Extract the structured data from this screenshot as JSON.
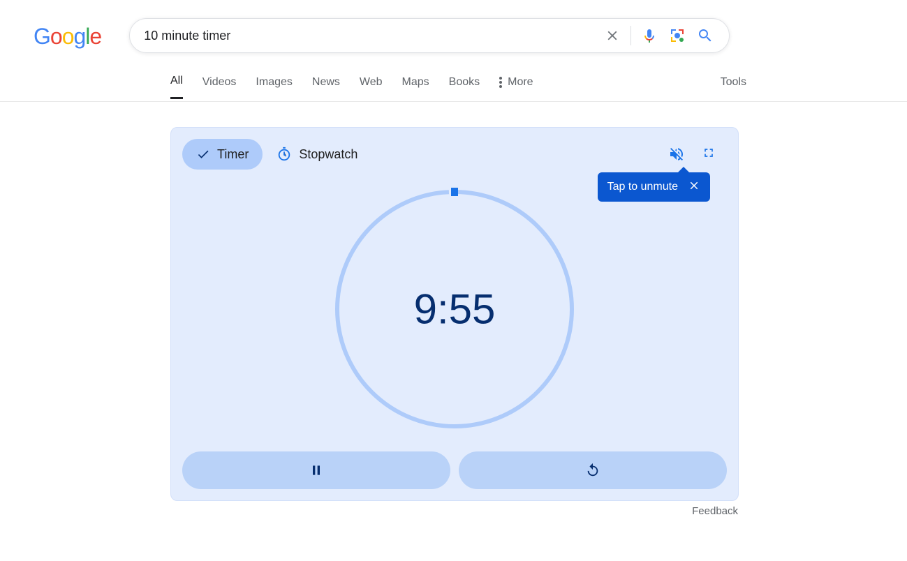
{
  "search": {
    "query": "10 minute timer"
  },
  "tabs": {
    "all": "All",
    "videos": "Videos",
    "images": "Images",
    "news": "News",
    "web": "Web",
    "maps": "Maps",
    "books": "Books",
    "more": "More",
    "tools": "Tools"
  },
  "timer": {
    "mode_timer": "Timer",
    "mode_stopwatch": "Stopwatch",
    "time_display": "9:55",
    "tooltip_text": "Tap to unmute",
    "progress_fraction": 0.992
  },
  "feedback_label": "Feedback"
}
